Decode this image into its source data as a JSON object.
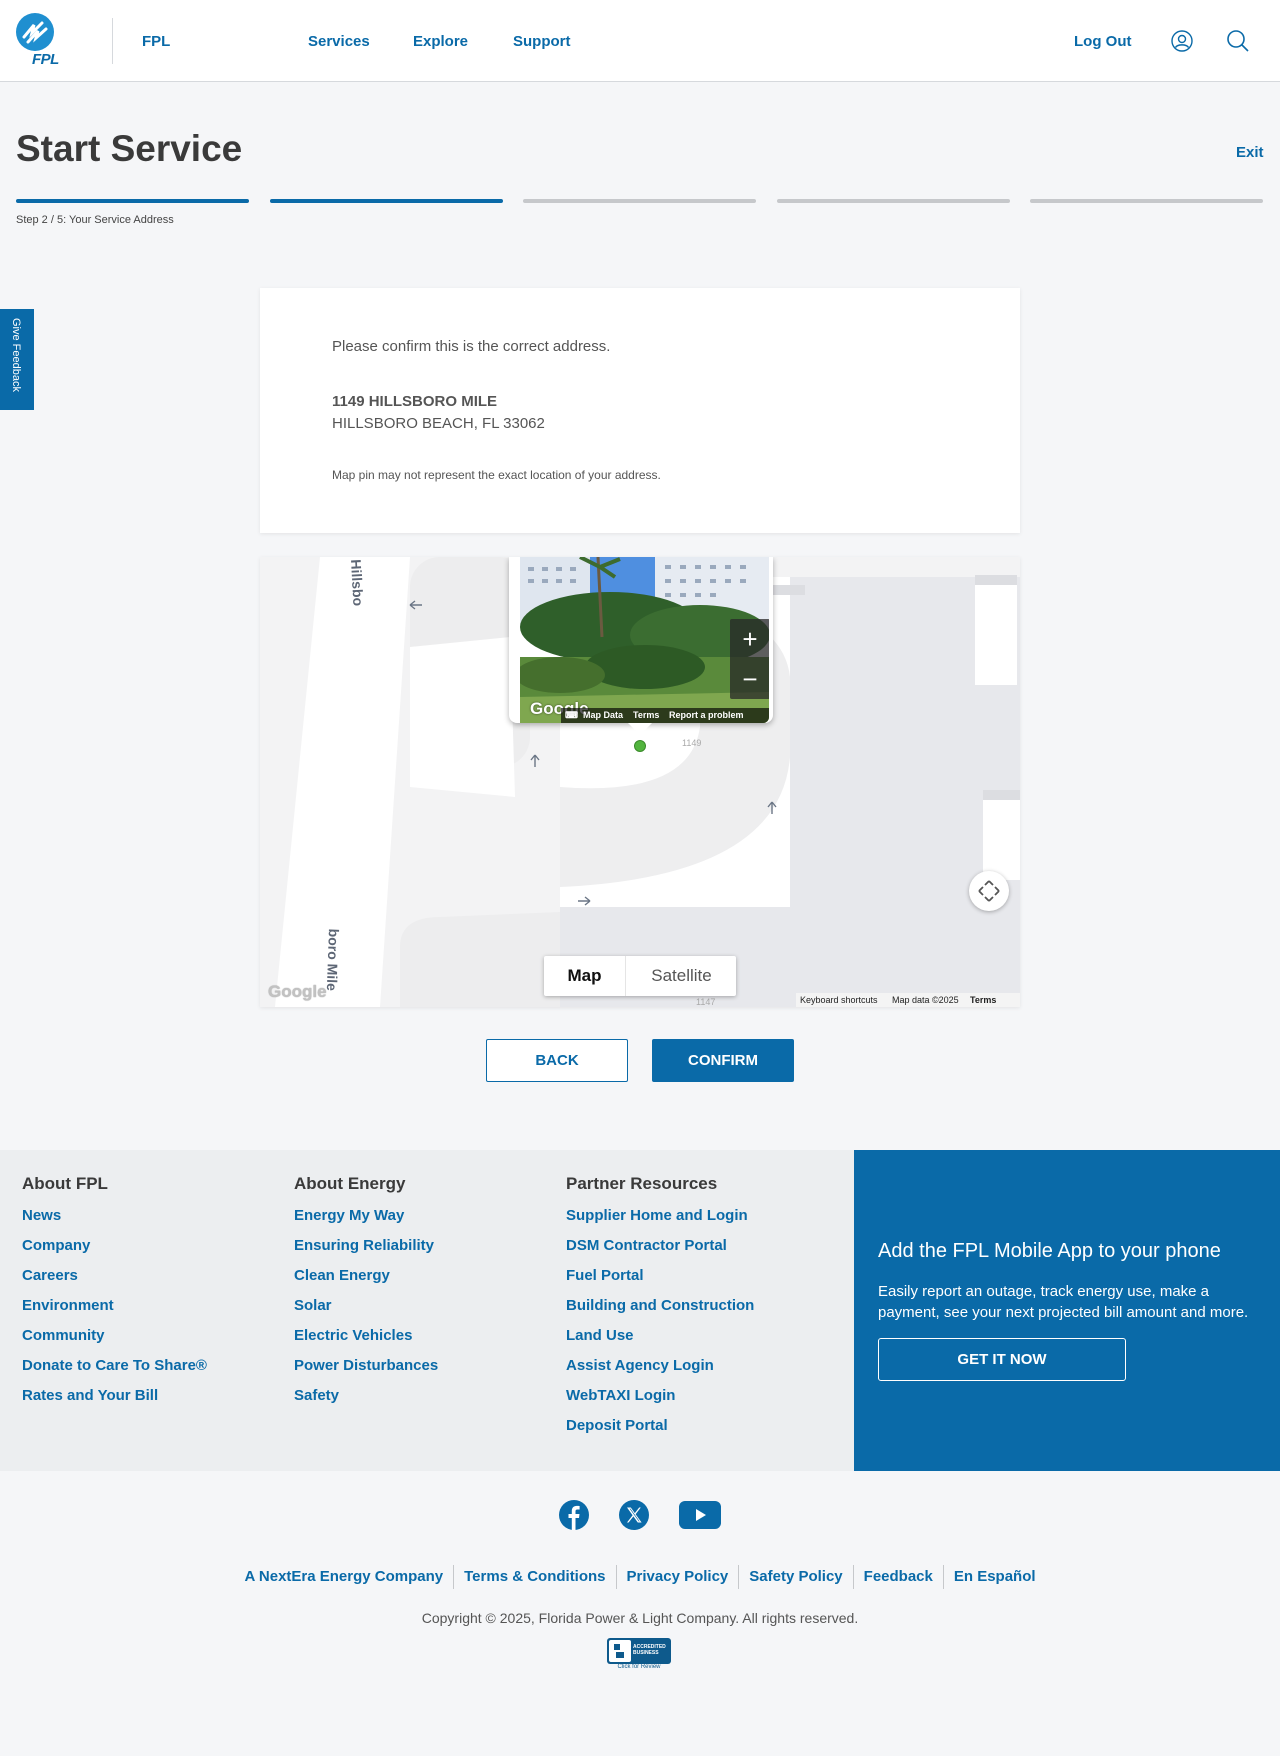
{
  "header": {
    "brand": "FPL",
    "logo_text": "FPL",
    "nav": [
      "Services",
      "Explore",
      "Support"
    ],
    "logout": "Log Out"
  },
  "page": {
    "title": "Start Service",
    "exit": "Exit",
    "step_text": "Step 2 / 5: Your Service Address",
    "steps_total": 5,
    "steps_done": 2,
    "feedback": "Give Feedback"
  },
  "card": {
    "question": "Please confirm this is the correct address.",
    "address_line1": "1149 HILLSBORO MILE",
    "address_line2": "HILLSBORO BEACH, FL 33062",
    "note": "Map pin may not represent the exact location of your address."
  },
  "map": {
    "street_top": "Hillsbo",
    "street_bottom": "boro Mile",
    "label_1149": "1149",
    "label_1147": "1147",
    "map_type": "Map",
    "satellite_type": "Satellite",
    "google": "Google",
    "keyboard": "Keyboard shortcuts",
    "map_data": "Map data ©2025",
    "terms": "Terms",
    "sv_map_data": "Map Data",
    "sv_terms": "Terms",
    "sv_report": "Report a problem",
    "zoom_in": "+",
    "zoom_out": "−"
  },
  "buttons": {
    "back": "BACK",
    "confirm": "CONFIRM"
  },
  "footer": {
    "cols": [
      {
        "heading": "About FPL",
        "links": [
          "News",
          "Company",
          "Careers",
          "Environment",
          "Community",
          "Donate to Care To Share®",
          "Rates and Your Bill"
        ]
      },
      {
        "heading": "About Energy",
        "links": [
          "Energy My Way",
          "Ensuring Reliability",
          "Clean Energy",
          "Solar",
          "Electric Vehicles",
          "Power Disturbances",
          "Safety"
        ]
      },
      {
        "heading": "Partner Resources",
        "links": [
          "Supplier Home and Login",
          "DSM Contractor Portal",
          "Fuel Portal",
          "Building and Construction",
          "Land Use",
          "Assist Agency Login",
          "WebTAXI Login",
          "Deposit Portal"
        ]
      }
    ],
    "promo_title": "Add the FPL Mobile App to your phone",
    "promo_text": "Easily report an outage, track energy use, make a payment, see your next projected bill amount and more.",
    "promo_button": "GET IT NOW",
    "legal": [
      "A NextEra Energy Company",
      "Terms & Conditions",
      "Privacy Policy",
      "Safety Policy",
      "Feedback",
      "En Español"
    ],
    "copyright": "Copyright © 2025, Florida Power & Light Company. All rights reserved.",
    "bbb_text": "ACCREDITED BUSINESS",
    "bbb_caption": "Click for Review"
  },
  "colors": {
    "brand_blue": "#0a6aa8",
    "logo_blue": "#1f8fd0"
  },
  "icons": [
    "user-icon",
    "search-icon",
    "facebook-icon",
    "x-icon",
    "youtube-icon",
    "fullscreen-icon"
  ]
}
